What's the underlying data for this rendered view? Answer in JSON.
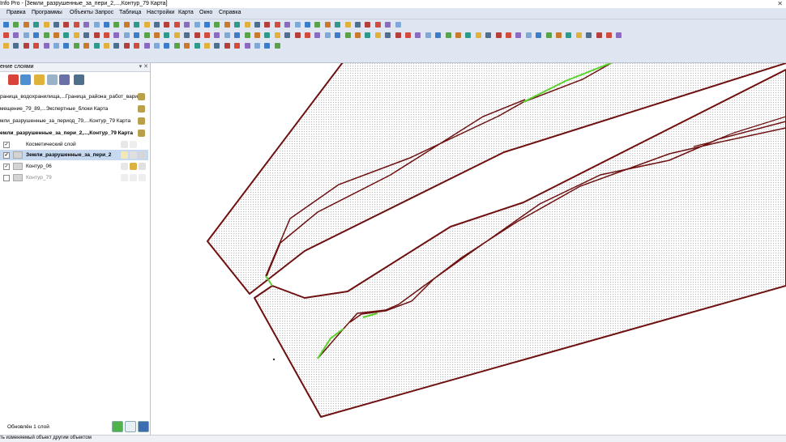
{
  "window": {
    "title": "Info Pro - [Земли_разрушенные_за_пери_2,...,Контур_79 Карта]",
    "close_glyph": "✕"
  },
  "menu": [
    "Правка",
    "Программы",
    "Объекты",
    "Запрос",
    "Таблица",
    "Настройки",
    "Карта",
    "Окно",
    "Справка"
  ],
  "panel": {
    "title": "ение слоями",
    "header_buttons": "▾ ✕",
    "groups": [
      {
        "label": "раница_водохранилища,...Граница_района_работ_вариа",
        "bold": false
      },
      {
        "label": "мещение_79_89,...Экспертные_блоки Карта",
        "bold": false
      },
      {
        "label": "мли_разрушенные_за_период_79,...Контур_79 Карта",
        "bold": false
      },
      {
        "label": "емли_разрушенные_за_пери_2,...,Контур_79 Карта",
        "bold": true
      }
    ],
    "layers": [
      {
        "label": "Косметический слой",
        "checked": true,
        "selected": false,
        "bold": false
      },
      {
        "label": "Земли_разрушенные_за_пери_2",
        "checked": true,
        "selected": true,
        "bold": true
      },
      {
        "label": "Контур_06",
        "checked": true,
        "selected": false,
        "bold": false
      },
      {
        "label": "Контур_79",
        "checked": false,
        "selected": false,
        "bold": false
      }
    ],
    "status": "Обновлён 1 слой"
  },
  "bottom_status": "ть изменяемый объект другим объектом",
  "colors": {
    "polygon_stroke": "#6e1010",
    "highlight_line": "#5ad12a",
    "fill_dots": "#bdbdbd"
  }
}
